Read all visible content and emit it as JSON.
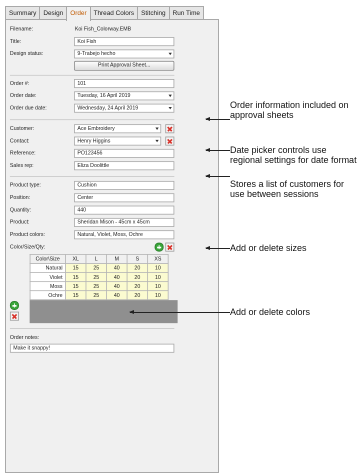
{
  "tabs": [
    {
      "label": "Summary",
      "active": false
    },
    {
      "label": "Design",
      "active": false
    },
    {
      "label": "Order",
      "active": true
    },
    {
      "label": "Thread Colors",
      "active": false
    },
    {
      "label": "Stitching",
      "active": false
    },
    {
      "label": "Run Time",
      "active": false
    }
  ],
  "fields": {
    "filename_label": "Filename:",
    "filename_value": "Koi Fish_Colorway.EMB",
    "title_label": "Title:",
    "title_value": "Koi Fish",
    "design_status_label": "Design status:",
    "design_status_value": "9-Trabejo hecho",
    "print_button": "Print Approval Sheet...",
    "order_no_label": "Order #:",
    "order_no_value": "101",
    "order_date_label": "Order date:",
    "order_date_value": "Tuesday, 16 April 2019",
    "order_due_label": "Order due date:",
    "order_due_value": "Wednesday, 24 April 2019",
    "customer_label": "Customer:",
    "customer_value": "Ace Embroidery",
    "contact_label": "Contact:",
    "contact_value": "Henry Higgins",
    "reference_label": "Reference:",
    "reference_value": "PO123456",
    "sales_rep_label": "Sales rep:",
    "sales_rep_value": "Eliza Doolittle",
    "product_type_label": "Product type:",
    "product_type_value": "Cushion",
    "position_label": "Position:",
    "position_value": "Center",
    "quantity_label": "Quantity:",
    "quantity_value": "440",
    "product_label": "Product:",
    "product_value": "Sheridan Mison - 45cm x 45cm",
    "product_colors_label": "Product colors:",
    "product_colors_value": "Natural, Violet, Moss, Ochre",
    "color_size_qty_label": "Color/Size/Qty:",
    "order_notes_label": "Order notes:",
    "order_notes_value": "Make it snappy!"
  },
  "grid": {
    "header": [
      "Color\\Size",
      "XL",
      "L",
      "M",
      "S",
      "XS"
    ],
    "rows": [
      {
        "color": "Natural",
        "values": [
          "15",
          "25",
          "40",
          "20",
          "10"
        ]
      },
      {
        "color": "Violet",
        "values": [
          "15",
          "25",
          "40",
          "20",
          "10"
        ]
      },
      {
        "color": "Moss",
        "values": [
          "15",
          "25",
          "40",
          "20",
          "10"
        ]
      },
      {
        "color": "Ochre",
        "values": [
          "15",
          "25",
          "40",
          "20",
          "10"
        ]
      }
    ]
  },
  "callouts": {
    "order_info": "Order information included on approval sheets",
    "date_picker": "Date picker controls use regional settings for date format",
    "customers": "Stores a list of customers for use between sessions",
    "sizes": "Add or delete sizes",
    "colors": "Add or delete colors"
  },
  "icons": {
    "add": "add-icon",
    "delete": "delete-icon",
    "dropdown": "chevron-down-icon"
  },
  "colors": {
    "active_tab": "#c15a00",
    "grid_cell": "#fbfbd0",
    "delete_red": "#d8322a",
    "add_green": "#3aa63a"
  }
}
